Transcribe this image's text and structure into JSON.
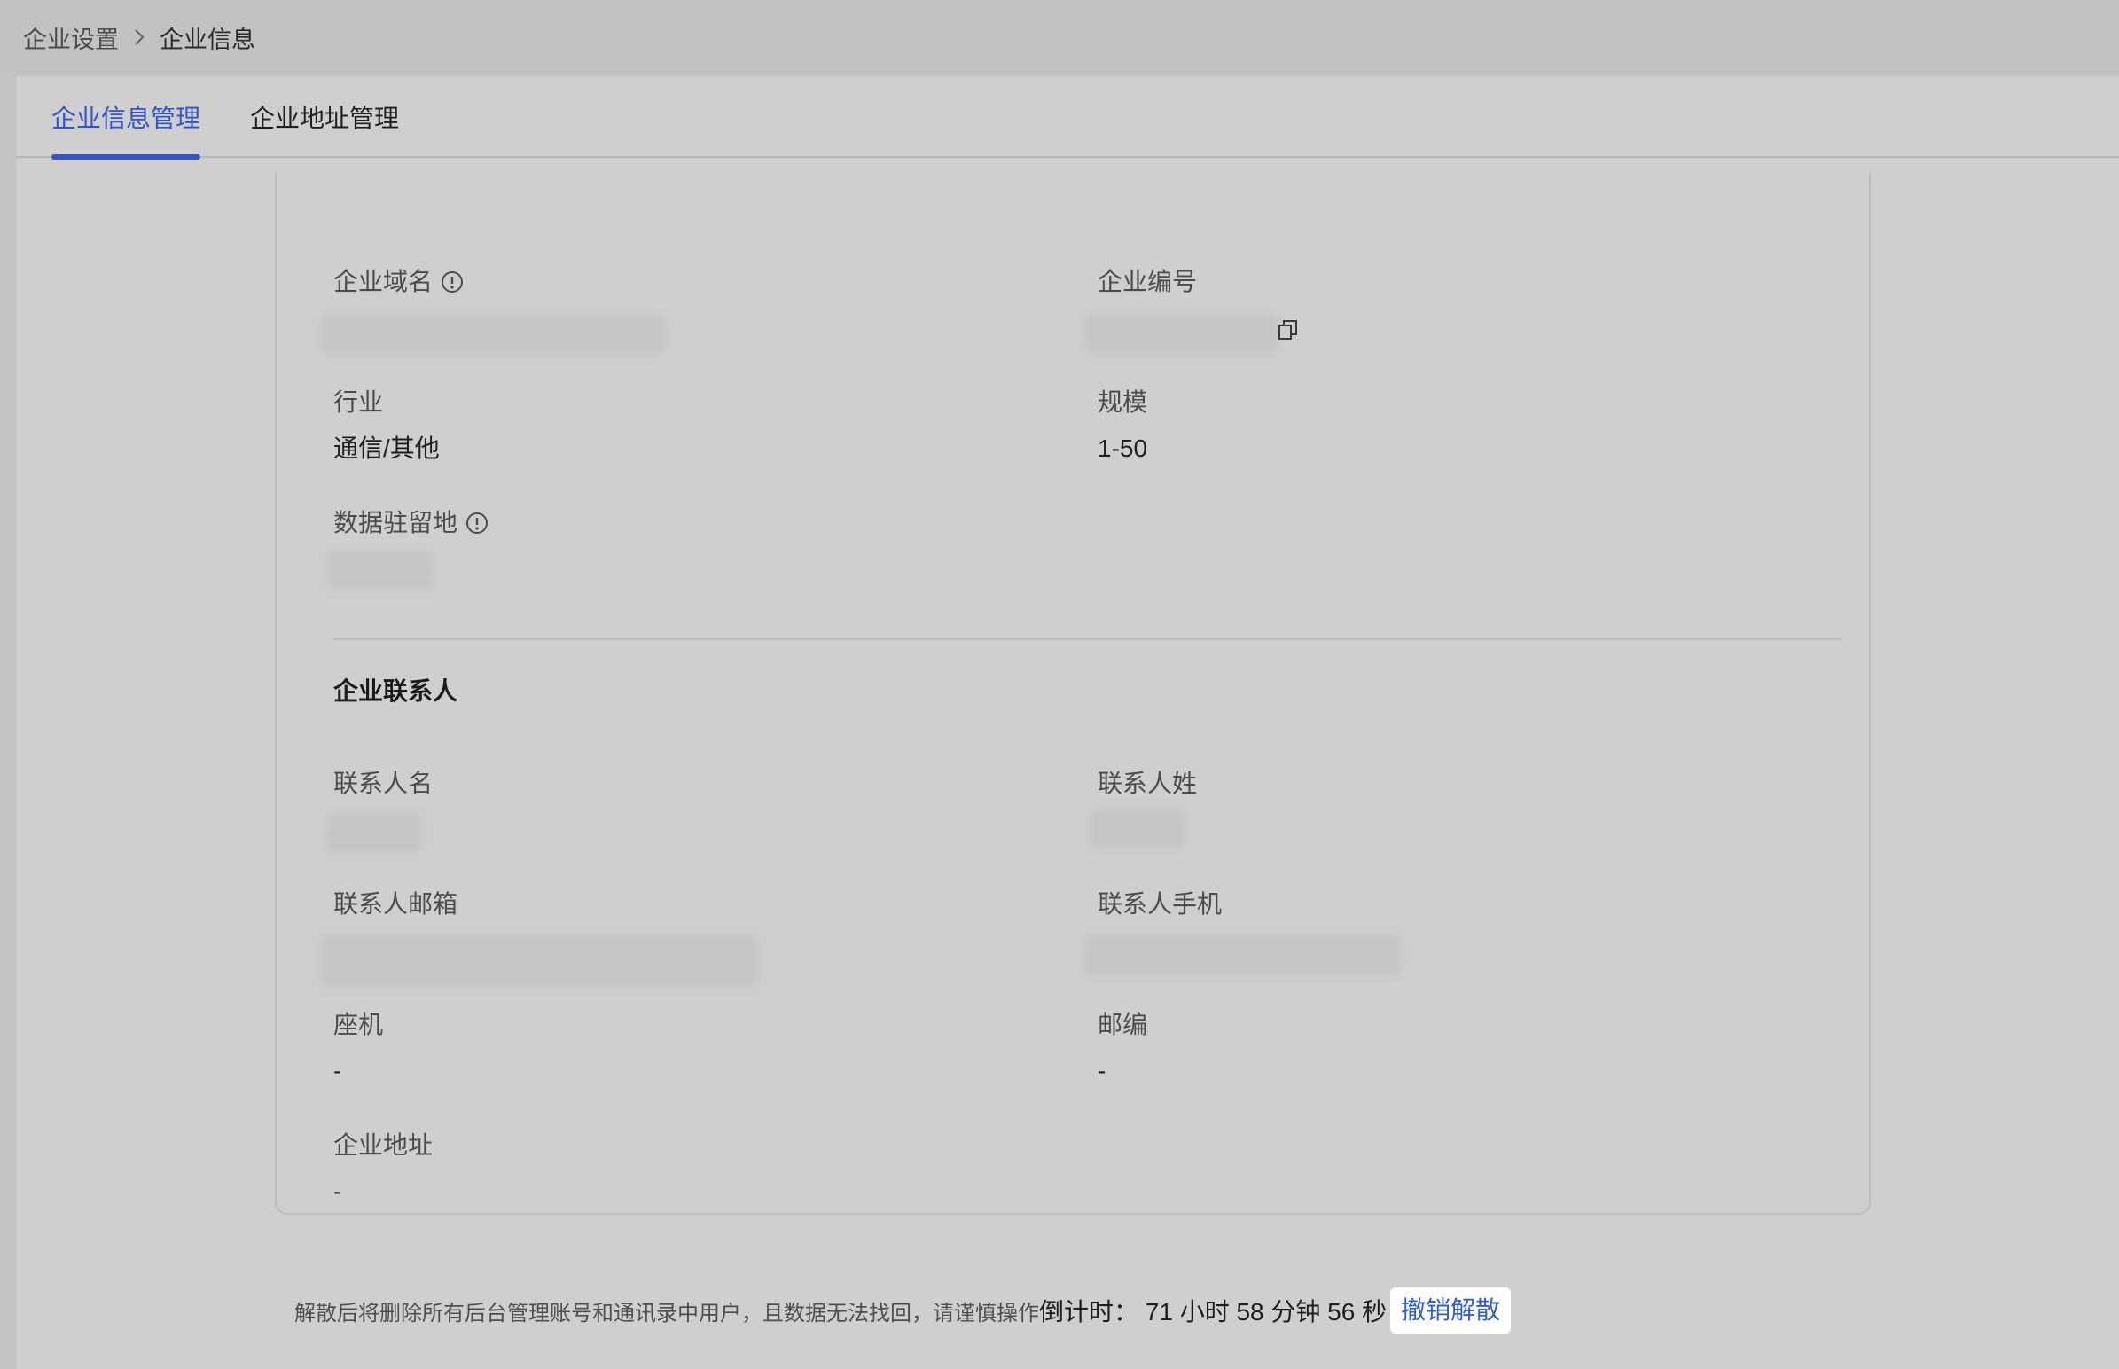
{
  "breadcrumb": {
    "parent": "企业设置",
    "current": "企业信息"
  },
  "tabs": [
    {
      "label": "企业信息管理",
      "active": true
    },
    {
      "label": "企业地址管理",
      "active": false
    }
  ],
  "fields": {
    "domain_label": "企业域名",
    "enterprise_id_label": "企业编号",
    "industry_label": "行业",
    "industry_value": "通信/其他",
    "scale_label": "规模",
    "scale_value": "1-50",
    "data_residency_label": "数据驻留地"
  },
  "contact": {
    "section_title": "企业联系人",
    "first_name_label": "联系人名",
    "last_name_label": "联系人姓",
    "email_label": "联系人邮箱",
    "phone_label": "联系人手机",
    "landline_label": "座机",
    "landline_value": "-",
    "postal_code_label": "邮编",
    "postal_code_value": "-",
    "address_label": "企业地址",
    "address_value": "-"
  },
  "footer": {
    "warning": "解散后将删除所有后台管理账号和通讯录中用户，且数据无法找回，请谨慎操作",
    "countdown": "倒计时： 71 小时 58 分钟 56 秒",
    "revoke_label": "撤销解散"
  },
  "colors": {
    "accent": "#3355cc",
    "link": "#2e5bd8"
  }
}
